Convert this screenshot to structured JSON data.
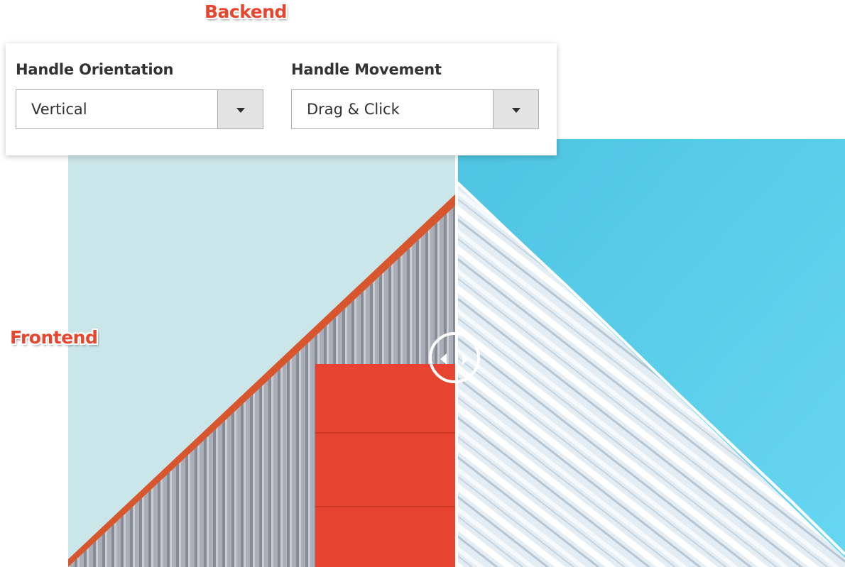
{
  "annotations": {
    "backend": "Backend",
    "frontend": "Frontend"
  },
  "settings": {
    "handle_orientation": {
      "label": "Handle Orientation",
      "selected": "Vertical",
      "icon": "chevron-down-icon"
    },
    "handle_movement": {
      "label": "Handle Movement",
      "selected": "Drag & Click",
      "icon": "chevron-down-icon"
    }
  },
  "slider": {
    "orientation": "vertical",
    "position_fraction": 0.5,
    "handle_icon": "left-right-arrows-icon"
  },
  "colors": {
    "callout": "#e8452e",
    "left_sky": "#cbe6e8",
    "right_sky": "#56cde9",
    "roof_trim": "#d8562e",
    "red_door": "#e64330",
    "siding": "#a4a9b3"
  }
}
